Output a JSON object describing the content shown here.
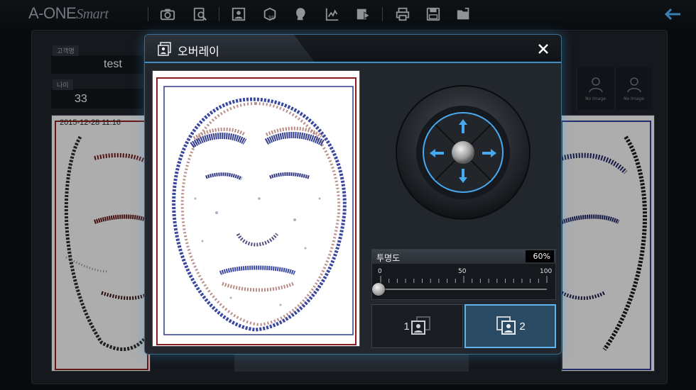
{
  "app": {
    "logo_main": "A-ONE",
    "logo_sub": "Smart"
  },
  "toolbar": {
    "icons": [
      "camera-icon",
      "search-document-icon",
      "portrait-icon",
      "3d-cube-icon",
      "face-icon",
      "chart-icon",
      "video-play-icon",
      "printer-icon",
      "save-icon",
      "open-folder-icon"
    ],
    "back_icon": "arrow-left-icon"
  },
  "customer": {
    "name_label": "고객명",
    "name_value": "test",
    "age_label": "나이",
    "age_value": "33"
  },
  "thumbnails": [
    {
      "label": "No Image"
    },
    {
      "label": "No Image"
    }
  ],
  "background_image": {
    "timestamp": "2015-12-28 11:16"
  },
  "modal": {
    "title": "오버레이",
    "close_icon": "close-icon",
    "opacity": {
      "label": "투명도",
      "value_text": "60%",
      "value": 60,
      "min_label": "0",
      "mid_label": "50",
      "max_label": "100"
    },
    "order_buttons": [
      {
        "number": "1",
        "active": false
      },
      {
        "number": "2",
        "active": true
      }
    ]
  },
  "colors": {
    "accent": "#5fb4ea",
    "arrow": "#49a9f0",
    "face_red": "#8a1e1e",
    "face_blue": "#2e3a8c"
  }
}
